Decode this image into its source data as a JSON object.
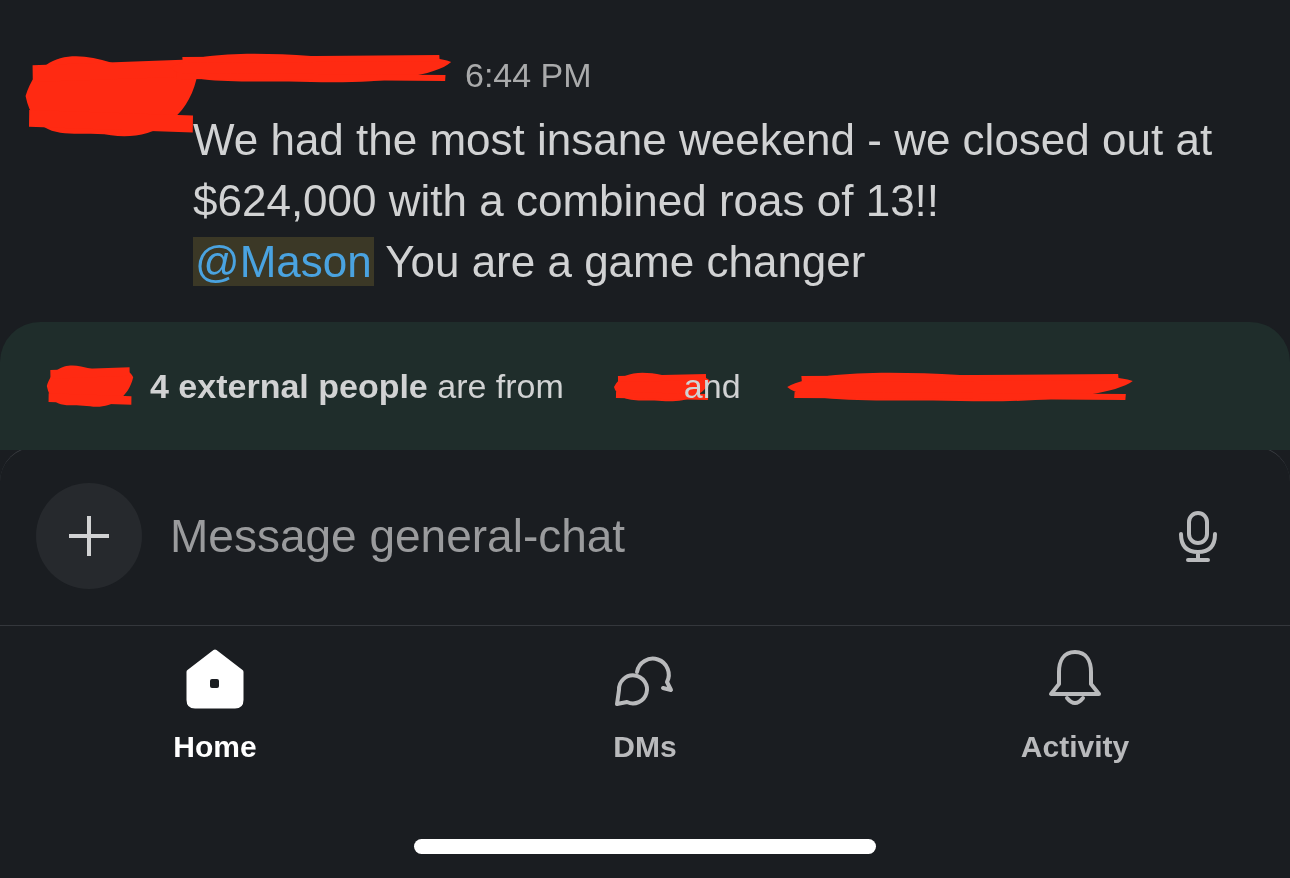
{
  "message": {
    "time": "6:44 PM",
    "text": "We had the most insane weekend - we closed out at $624,000 with a combined roas of 13!!",
    "mention": "@Mason",
    "text_after": " You are a game changer"
  },
  "banner": {
    "bold": "4 external people",
    "text": "are from",
    "joiner": "and"
  },
  "composer": {
    "placeholder": "Message general-chat"
  },
  "tabs": [
    {
      "label": "Home",
      "kind": "home",
      "selected": true
    },
    {
      "label": "DMs",
      "kind": "dms",
      "selected": false
    },
    {
      "label": "Activity",
      "kind": "bell",
      "selected": false
    }
  ]
}
